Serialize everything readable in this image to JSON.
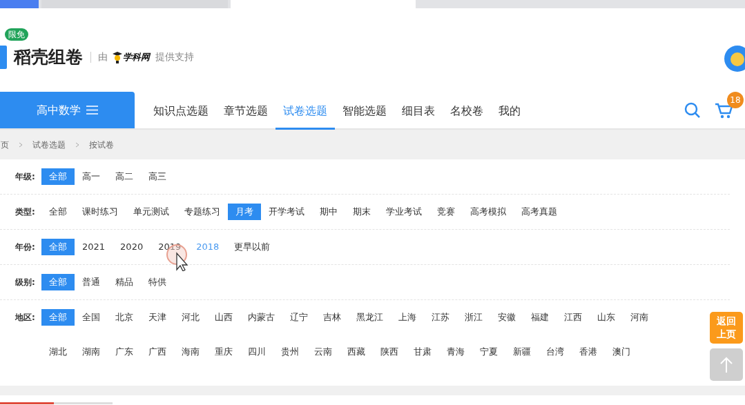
{
  "brand": {
    "badge": "限免",
    "name": "稻壳组卷",
    "by": "由",
    "partner": "学科网",
    "support": "提供支持"
  },
  "subject": {
    "label": "高中数学"
  },
  "nav": [
    {
      "label": "知识点选题",
      "selected": false
    },
    {
      "label": "章节选题",
      "selected": false
    },
    {
      "label": "试卷选题",
      "selected": true
    },
    {
      "label": "智能选题",
      "selected": false
    },
    {
      "label": "细目表",
      "selected": false
    },
    {
      "label": "名校卷",
      "selected": false
    },
    {
      "label": "我的",
      "selected": false
    }
  ],
  "cart": {
    "count": "18"
  },
  "breadcrumb": [
    "页",
    "试卷选题",
    "按试卷"
  ],
  "filters": [
    {
      "label": "年级:",
      "options": [
        {
          "label": "全部",
          "selected": true
        },
        {
          "label": "高一",
          "selected": false
        },
        {
          "label": "高二",
          "selected": false
        },
        {
          "label": "高三",
          "selected": false
        }
      ]
    },
    {
      "label": "类型:",
      "options": [
        {
          "label": "全部",
          "selected": false
        },
        {
          "label": "课时练习",
          "selected": false
        },
        {
          "label": "单元测试",
          "selected": false
        },
        {
          "label": "专题练习",
          "selected": false
        },
        {
          "label": "月考",
          "selected": true
        },
        {
          "label": "开学考试",
          "selected": false
        },
        {
          "label": "期中",
          "selected": false
        },
        {
          "label": "期末",
          "selected": false
        },
        {
          "label": "学业考试",
          "selected": false
        },
        {
          "label": "竞赛",
          "selected": false
        },
        {
          "label": "高考模拟",
          "selected": false
        },
        {
          "label": "高考真题",
          "selected": false
        }
      ]
    },
    {
      "label": "年份:",
      "options": [
        {
          "label": "全部",
          "selected": true
        },
        {
          "label": "2021",
          "selected": false
        },
        {
          "label": "2020",
          "selected": false
        },
        {
          "label": "2019",
          "selected": false
        },
        {
          "label": "2018",
          "selected": false,
          "hovered": true
        },
        {
          "label": "更早以前",
          "selected": false
        }
      ]
    },
    {
      "label": "级别:",
      "options": [
        {
          "label": "全部",
          "selected": true
        },
        {
          "label": "普通",
          "selected": false
        },
        {
          "label": "精品",
          "selected": false
        },
        {
          "label": "特供",
          "selected": false
        }
      ]
    },
    {
      "label": "地区:",
      "options": [
        {
          "label": "全部",
          "selected": true
        },
        {
          "label": "全国",
          "selected": false
        },
        {
          "label": "北京",
          "selected": false
        },
        {
          "label": "天津",
          "selected": false
        },
        {
          "label": "河北",
          "selected": false
        },
        {
          "label": "山西",
          "selected": false
        },
        {
          "label": "内蒙古",
          "selected": false
        },
        {
          "label": "辽宁",
          "selected": false
        },
        {
          "label": "吉林",
          "selected": false
        },
        {
          "label": "黑龙江",
          "selected": false
        },
        {
          "label": "上海",
          "selected": false
        },
        {
          "label": "江苏",
          "selected": false
        },
        {
          "label": "浙江",
          "selected": false
        },
        {
          "label": "安徽",
          "selected": false
        },
        {
          "label": "福建",
          "selected": false
        },
        {
          "label": "江西",
          "selected": false
        },
        {
          "label": "山东",
          "selected": false
        },
        {
          "label": "河南",
          "selected": false
        },
        {
          "label": "湖北",
          "selected": false
        },
        {
          "label": "湖南",
          "selected": false
        },
        {
          "label": "广东",
          "selected": false
        },
        {
          "label": "广西",
          "selected": false
        },
        {
          "label": "海南",
          "selected": false
        },
        {
          "label": "重庆",
          "selected": false
        },
        {
          "label": "四川",
          "selected": false
        },
        {
          "label": "贵州",
          "selected": false
        },
        {
          "label": "云南",
          "selected": false
        },
        {
          "label": "西藏",
          "selected": false
        },
        {
          "label": "陕西",
          "selected": false
        },
        {
          "label": "甘肃",
          "selected": false
        },
        {
          "label": "青海",
          "selected": false
        },
        {
          "label": "宁夏",
          "selected": false
        },
        {
          "label": "新疆",
          "selected": false
        },
        {
          "label": "台湾",
          "selected": false
        },
        {
          "label": "香港",
          "selected": false
        },
        {
          "label": "澳门",
          "selected": false
        }
      ]
    }
  ],
  "back_button": "返回上页"
}
